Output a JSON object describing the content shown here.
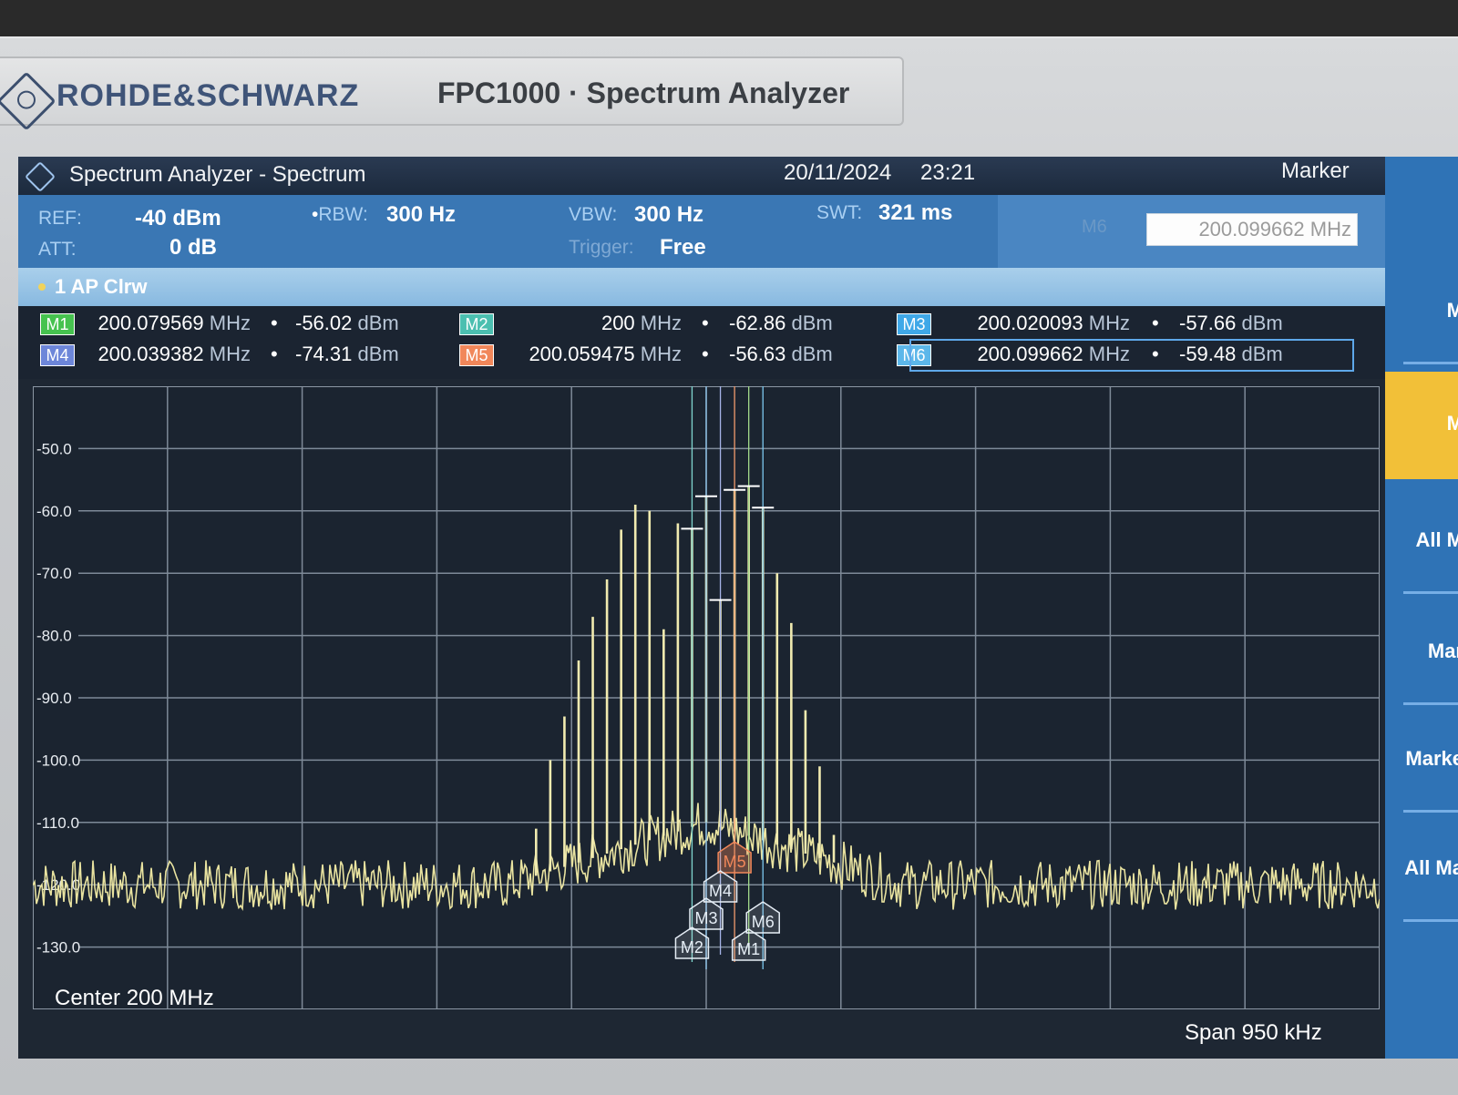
{
  "device": {
    "brand": "ROHDE&SCHWARZ",
    "model": "FPC1000 · Spectrum Analyzer"
  },
  "titlebar": {
    "title": "Spectrum Analyzer - Spectrum",
    "date": "20/11/2024",
    "time": "23:21",
    "mode": "Marker"
  },
  "params": {
    "ref_label": "REF:",
    "ref_value": "-40 dBm",
    "att_label": "ATT:",
    "att_value": "0 dB",
    "rbw_label": "RBW:",
    "rbw_value": "300 Hz",
    "vbw_label": "VBW:",
    "vbw_value": "300 Hz",
    "trigger_label": "Trigger:",
    "trigger_value": "Free",
    "swt_label": "SWT:",
    "swt_value": "321 ms",
    "marker_input_label": "M6",
    "marker_input_value": "200.099662 MHz"
  },
  "trace": {
    "label": "1 AP Clrw"
  },
  "markers": [
    {
      "id": "M1",
      "freq": "200.079569",
      "level": "-56.02",
      "tag_color": "#46c24f"
    },
    {
      "id": "M2",
      "freq": "200",
      "level": "-62.86",
      "tag_color": "#4bbfb0"
    },
    {
      "id": "M3",
      "freq": "200.020093",
      "level": "-57.66",
      "tag_color": "#3fa8e8"
    },
    {
      "id": "M4",
      "freq": "200.039382",
      "level": "-74.31",
      "tag_color": "#6d86d9"
    },
    {
      "id": "M5",
      "freq": "200.059475",
      "level": "-56.63",
      "tag_color": "#f1875a"
    },
    {
      "id": "M6",
      "freq": "200.099662",
      "level": "-59.48",
      "tag_color": "#5cb7ea"
    }
  ],
  "units": {
    "freq": "MHz",
    "level": "dBm"
  },
  "plot": {
    "center_label": "Center 200 MHz",
    "span_label": "Span 950 kHz",
    "y_ticks": [
      "-50.0",
      "-60.0",
      "-70.0",
      "-80.0",
      "-90.0",
      "-100.0",
      "-110.0",
      "-120.0",
      "-130.0"
    ]
  },
  "sidebar": {
    "items": [
      "M",
      "M",
      "All M",
      "Mar",
      "Marke",
      "All Ma"
    ]
  },
  "chart_data": {
    "type": "line",
    "xlabel": "",
    "ylabel": "",
    "center_mhz": 200,
    "span_khz": 950,
    "ylim": [
      -140,
      -40
    ],
    "noise_floor_dbm": -120,
    "peaks": [
      {
        "offset_khz": -120,
        "level": -111
      },
      {
        "offset_khz": -110,
        "level": -100
      },
      {
        "offset_khz": -100,
        "level": -93
      },
      {
        "offset_khz": -90,
        "level": -84
      },
      {
        "offset_khz": -80,
        "level": -77
      },
      {
        "offset_khz": -70,
        "level": -71
      },
      {
        "offset_khz": -60,
        "level": -63
      },
      {
        "offset_khz": -50,
        "level": -59
      },
      {
        "offset_khz": -40,
        "level": -60
      },
      {
        "offset_khz": -30,
        "level": -79
      },
      {
        "offset_khz": -20,
        "level": -62
      },
      {
        "offset_khz": -10,
        "level": -62.86
      },
      {
        "offset_khz": 0,
        "level": -57.66
      },
      {
        "offset_khz": 10,
        "level": -74.31
      },
      {
        "offset_khz": 20,
        "level": -56.63
      },
      {
        "offset_khz": 30,
        "level": -56.02
      },
      {
        "offset_khz": 40,
        "level": -59.48
      },
      {
        "offset_khz": 50,
        "level": -70
      },
      {
        "offset_khz": 60,
        "level": -78
      },
      {
        "offset_khz": 70,
        "level": -92
      },
      {
        "offset_khz": 80,
        "level": -101
      },
      {
        "offset_khz": 90,
        "level": -112
      }
    ]
  }
}
